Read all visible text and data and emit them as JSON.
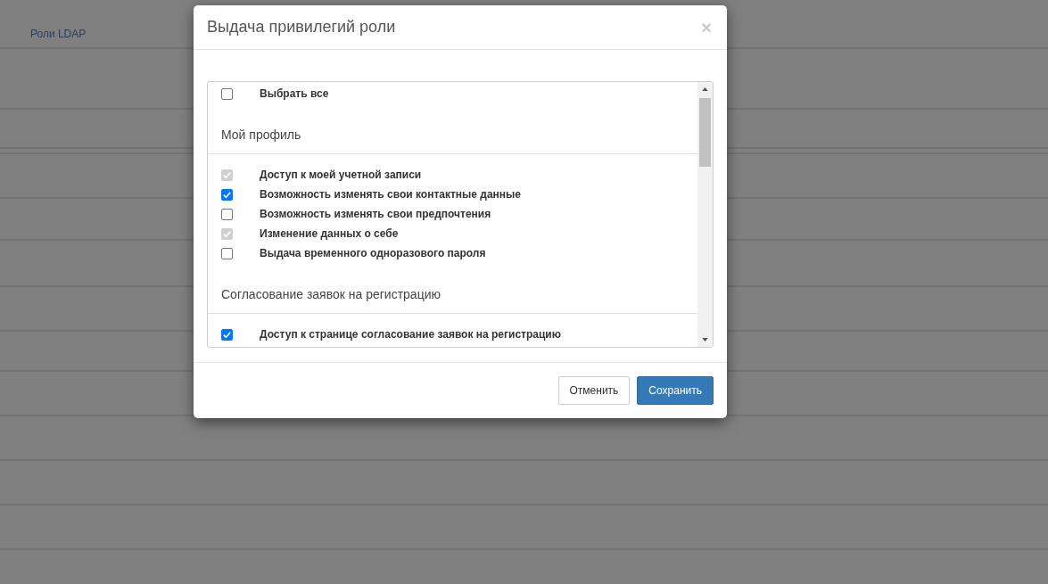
{
  "background": {
    "link": "Роли LDAP"
  },
  "modal": {
    "title": "Выдача привилегий роли",
    "close": "×",
    "select_all": {
      "label": "Выбрать все",
      "checked": false,
      "disabled": false
    },
    "sections": [
      {
        "title": "Мой профиль",
        "items": [
          {
            "label": "Доступ к моей учетной записи",
            "checked": true,
            "disabled": true
          },
          {
            "label": "Возможность изменять свои контактные данные",
            "checked": true,
            "disabled": false
          },
          {
            "label": "Возможность изменять свои предпочтения",
            "checked": false,
            "disabled": false
          },
          {
            "label": "Изменение данных о себе",
            "checked": true,
            "disabled": true
          },
          {
            "label": "Выдача временного одноразового пароля",
            "checked": false,
            "disabled": false
          }
        ]
      },
      {
        "title": "Согласование заявок на регистрацию",
        "items": [
          {
            "label": "Доступ к странице согласование заявок на регистрацию",
            "checked": true,
            "disabled": false
          }
        ]
      }
    ],
    "buttons": [
      {
        "label": "Отменить",
        "kind": "default"
      },
      {
        "label": "Сохранить",
        "kind": "primary"
      }
    ]
  }
}
